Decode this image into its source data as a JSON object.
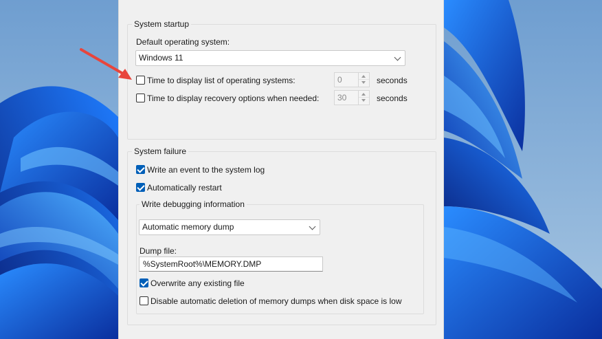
{
  "system_startup": {
    "title": "System startup",
    "default_os_label": "Default operating system:",
    "default_os_value": "Windows 11",
    "time_list_label": "Time to display list of operating systems:",
    "time_list_checked": false,
    "time_list_value": "0",
    "time_list_unit": "seconds",
    "time_recovery_label": "Time to display recovery options when needed:",
    "time_recovery_checked": false,
    "time_recovery_value": "30",
    "time_recovery_unit": "seconds"
  },
  "system_failure": {
    "title": "System failure",
    "write_event_label": "Write an event to the system log",
    "write_event_checked": true,
    "auto_restart_label": "Automatically restart",
    "auto_restart_checked": true,
    "debug_info": {
      "title": "Write debugging information",
      "dump_type_value": "Automatic memory dump",
      "dump_file_label": "Dump file:",
      "dump_file_value": "%SystemRoot%\\MEMORY.DMP",
      "overwrite_label": "Overwrite any existing file",
      "overwrite_checked": true,
      "disable_deletion_label": "Disable automatic deletion of memory dumps when disk space is low",
      "disable_deletion_checked": false
    }
  },
  "colors": {
    "accent": "#005fb8",
    "annotation_arrow": "#e8453c"
  }
}
